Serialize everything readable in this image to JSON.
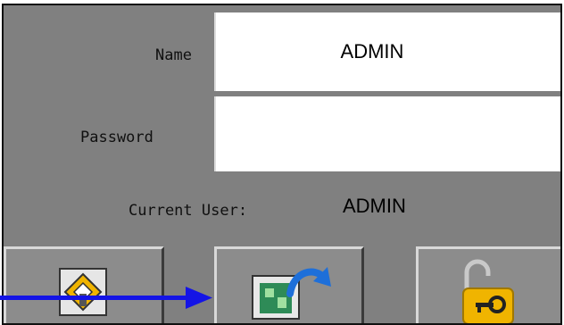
{
  "login": {
    "name_label": "Name",
    "name_value": "ADMIN",
    "password_label": "Password",
    "password_value": "",
    "current_user_label": "Current User:",
    "current_user_value": "ADMIN"
  },
  "buttons": [
    {
      "icon": "home-icon"
    },
    {
      "icon": "switch-user-icon"
    },
    {
      "icon": "lock-icon"
    }
  ],
  "colors": {
    "panel": "#808080",
    "arrow": "#1414e6",
    "lock": "#f0b400"
  }
}
